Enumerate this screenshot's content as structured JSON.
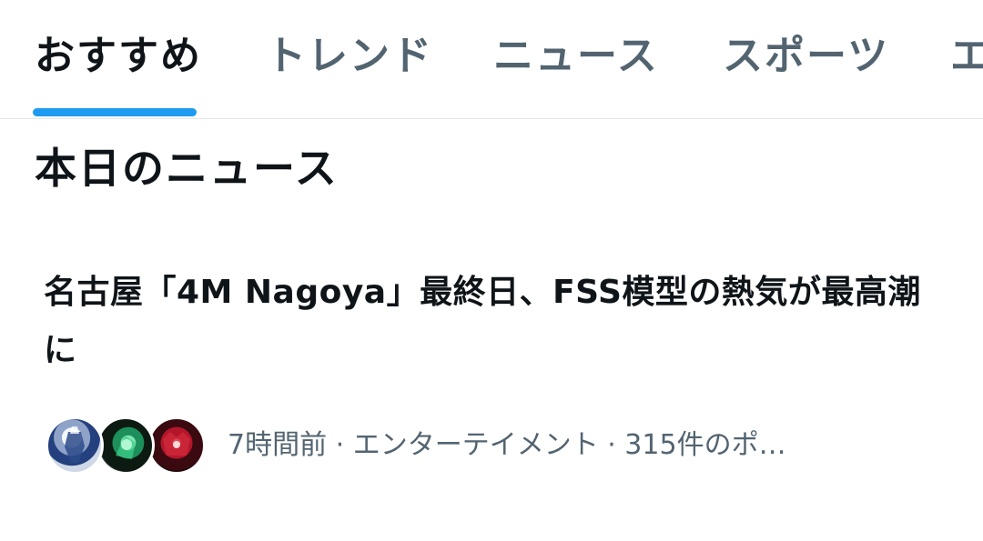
{
  "colors": {
    "accent": "#1d9bf0",
    "text_primary": "#0f1419",
    "text_secondary": "#536471",
    "divider": "#e1e6ea"
  },
  "tabs": [
    {
      "label": "おすすめ",
      "active": true
    },
    {
      "label": "トレンド",
      "active": false
    },
    {
      "label": "ニュース",
      "active": false
    },
    {
      "label": "スポーツ",
      "active": false
    },
    {
      "label": "エ",
      "active": false
    }
  ],
  "section": {
    "title": "本日のニュース"
  },
  "news_item": {
    "headline": "名古屋「4M Nagoya」最終日、FSS模型の熱気が最高潮に",
    "meta": "7時間前 · エンターテイメント · 315件のポ…",
    "avatars": [
      "avatar-1",
      "avatar-2",
      "avatar-3"
    ]
  }
}
